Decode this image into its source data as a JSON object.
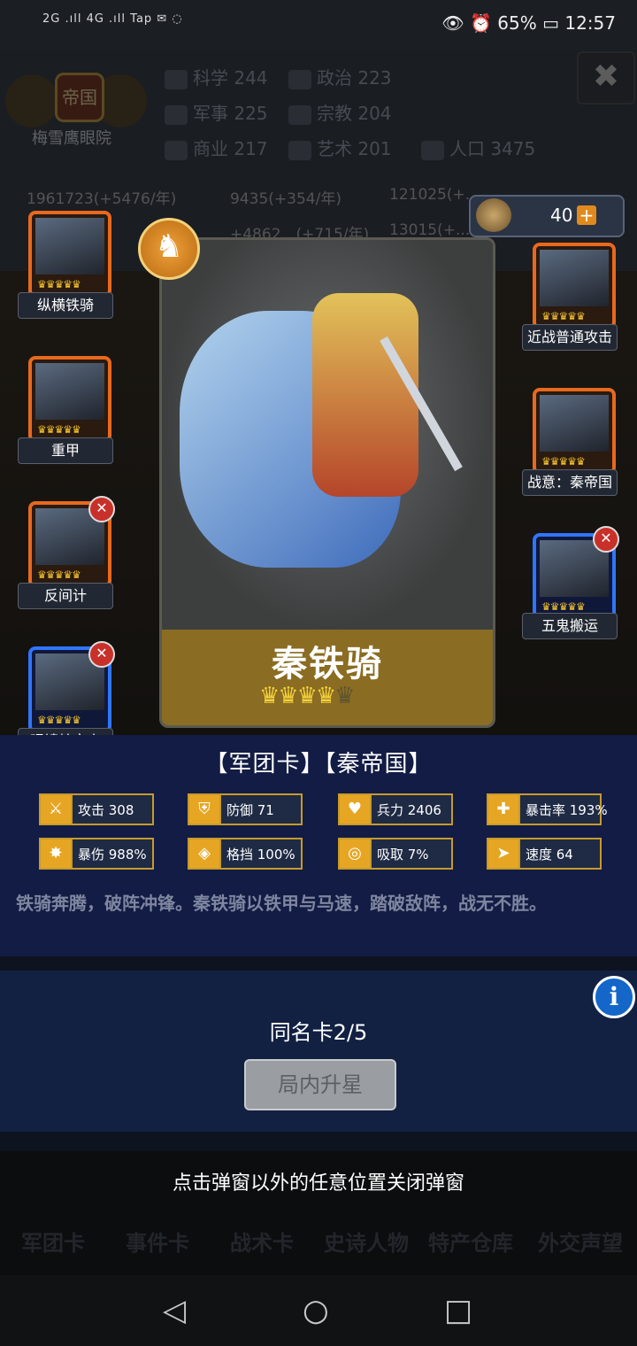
{
  "statusbar": {
    "left": "2G .ıll  4G .ıll  Tap  ✉  ◌",
    "right": "👁 ⏰ 65% ▭ 12:57"
  },
  "header": {
    "empire_badge": "帝国",
    "city": "梅雪鹰眼院",
    "stats": [
      {
        "label": "科学",
        "value": "244"
      },
      {
        "label": "政治",
        "value": "223"
      },
      {
        "label": "军事",
        "value": "225"
      },
      {
        "label": "宗教",
        "value": "204"
      },
      {
        "label": "商业",
        "value": "217"
      },
      {
        "label": "艺术",
        "value": "201"
      },
      {
        "label": "人口",
        "value": "3475"
      }
    ],
    "resources": [
      "1961723(+5476/年)",
      "9435(+354/年)",
      "121025(+..."
    ],
    "resources2": [
      "+4862…(+715/年)",
      "13015(+..."
    ]
  },
  "counter": {
    "value": "40",
    "plus": "+"
  },
  "left_cards": [
    {
      "label": "纵横铁骑",
      "border": "#e8691e",
      "remove": false
    },
    {
      "label": "重甲",
      "border": "#e8691e",
      "remove": false
    },
    {
      "label": "反间计",
      "border": "#e8691e",
      "remove": true
    },
    {
      "label": "眼镜蛇突击",
      "border": "#2f76ff",
      "remove": true
    }
  ],
  "right_cards": [
    {
      "label": "近战普通攻击",
      "border": "#e8691e",
      "remove": false
    },
    {
      "label": "战意：秦帝国",
      "border": "#e8691e",
      "remove": false
    },
    {
      "label": "五鬼搬运",
      "border": "#2f76ff",
      "remove": true
    }
  ],
  "main_card": {
    "name": "秦铁骑",
    "stars_filled": 4,
    "stars_total": 5
  },
  "tags": "【军团卡】【秦帝国】",
  "attributes": [
    {
      "label": "攻击 308",
      "icon": "sword-icon"
    },
    {
      "label": "防御 71",
      "icon": "shield-icon"
    },
    {
      "label": "兵力 2406",
      "icon": "heart-icon"
    },
    {
      "label": "暴击率 193%",
      "icon": "crit-icon"
    },
    {
      "label": "暴伤 988%",
      "icon": "burst-icon"
    },
    {
      "label": "格挡 100%",
      "icon": "block-icon"
    },
    {
      "label": "吸取 7%",
      "icon": "drain-icon"
    },
    {
      "label": "速度 64",
      "icon": "boot-icon"
    }
  ],
  "flavor": "铁骑奔腾，破阵冲锋。秦铁骑以铁甲与马速，踏破敌阵，战无不胜。",
  "duplicate": "同名卡2/5",
  "upgrade_button": "局内升星",
  "hint": "点击弹窗以外的任意位置关闭弹窗",
  "bottom_tabs": [
    "军团卡",
    "事件卡",
    "战术卡",
    "史诗人物",
    "特产仓库",
    "外交声望"
  ],
  "colors": {
    "orange_border": "#e8691e",
    "blue_border": "#2f76ff",
    "gold": "#c79a2c",
    "panel": "#121c44"
  }
}
